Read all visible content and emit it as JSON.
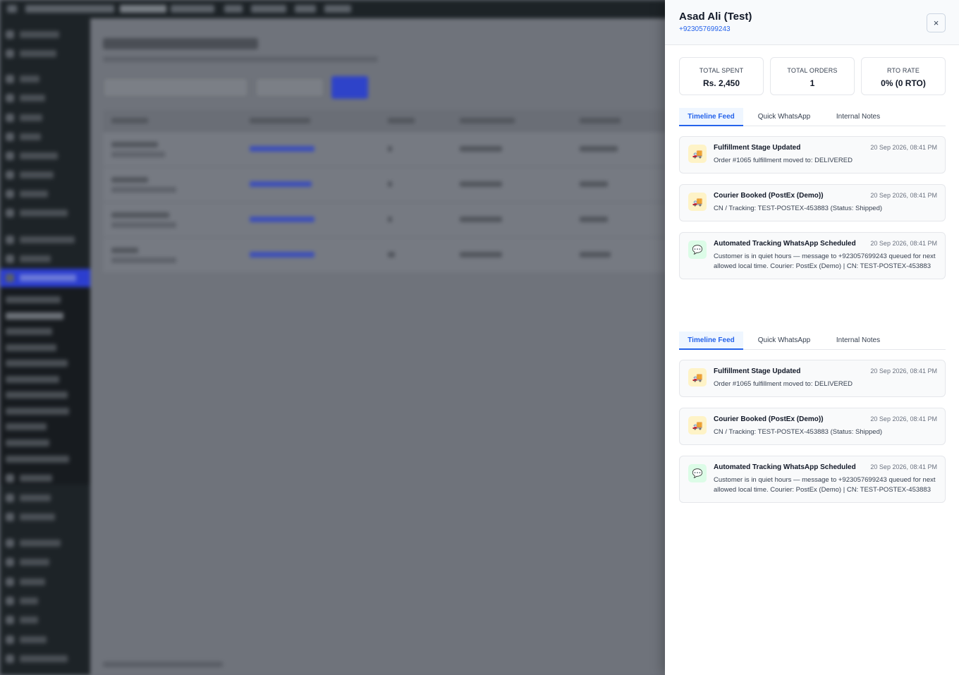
{
  "customer": {
    "name": "Asad Ali (Test)",
    "phone": "+923057699243"
  },
  "stats": [
    {
      "label": "TOTAL SPENT",
      "value": "Rs. 2,450"
    },
    {
      "label": "TOTAL ORDERS",
      "value": "1"
    },
    {
      "label": "RTO RATE",
      "value": "0% (0 RTO)"
    }
  ],
  "tabs": [
    {
      "label": "Timeline Feed",
      "active": true
    },
    {
      "label": "Quick WhatsApp",
      "active": false
    },
    {
      "label": "Internal Notes",
      "active": false
    }
  ],
  "timeline": [
    {
      "icon": "truck-icon",
      "title": "Fulfillment Stage Updated",
      "time": "20 Sep 2026, 08:41 PM",
      "description": "Order #1065 fulfillment moved to: DELIVERED"
    },
    {
      "icon": "truck-icon",
      "title": "Courier Booked (PostEx (Demo))",
      "time": "20 Sep 2026, 08:41 PM",
      "description": "CN / Tracking: TEST-POSTEX-453883 (Status: Shipped)"
    },
    {
      "icon": "chat-icon",
      "title": "Automated Tracking WhatsApp Scheduled",
      "time": "20 Sep 2026, 08:41 PM",
      "description": "Customer is in quiet hours — message to +923057699243 queued for next allowed local time. Courier: PostEx (Demo) | CN: TEST-POSTEX-453883"
    }
  ],
  "close_label": "×",
  "icon_glyphs": {
    "truck": "🚚",
    "chat": "💬"
  },
  "colors": {
    "accent": "#2563eb",
    "truck_bg": "#fef3c7",
    "chat_bg": "#dcfce7"
  }
}
